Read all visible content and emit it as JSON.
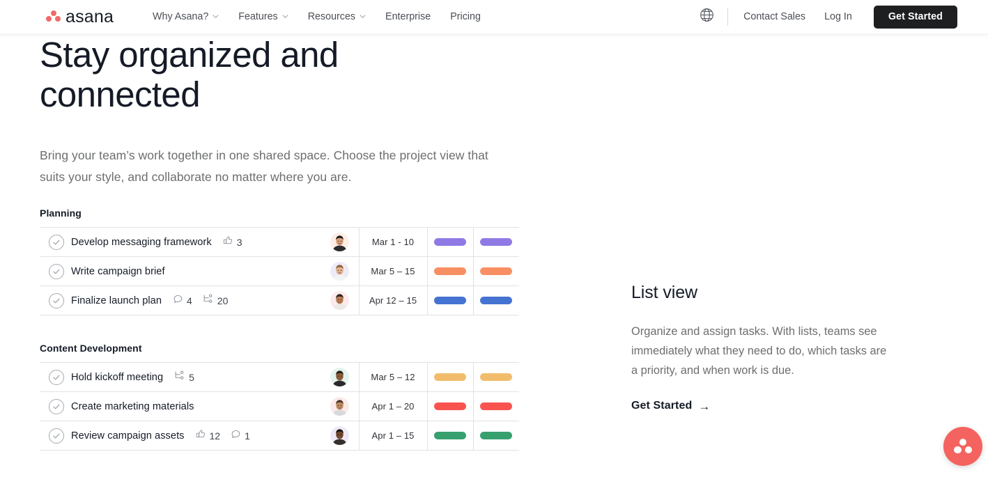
{
  "navbar": {
    "brand": {
      "name": "asana",
      "logo_color": "#f06a6a"
    },
    "links": [
      {
        "label": "Why Asana?",
        "has_dropdown": true
      },
      {
        "label": "Features",
        "has_dropdown": true
      },
      {
        "label": "Resources",
        "has_dropdown": true
      },
      {
        "label": "Enterprise",
        "has_dropdown": false
      },
      {
        "label": "Pricing",
        "has_dropdown": false
      }
    ],
    "language_icon": "globe-icon",
    "contact_sales": "Contact Sales",
    "log_in": "Log In",
    "get_started": "Get Started",
    "cta_bg": "#1e1f21"
  },
  "hero": {
    "heading": "Stay organized and connected",
    "subheading": "Bring your team’s work together in one shared space. Choose the project view that suits your style, and collaborate no matter where you are."
  },
  "board": {
    "groups": [
      {
        "title": "Planning",
        "tasks": [
          {
            "name": "Develop messaging framework",
            "meta": [
              {
                "icon": "thumbs-up-icon",
                "count": "3"
              }
            ],
            "avatar": "avatar-person-1",
            "avatar_bg": "#fdeee6",
            "date": "Mar 1 - 10",
            "tag1_color": "#8f7ae5",
            "tag2_color": "#8f7ae5"
          },
          {
            "name": "Write campaign brief",
            "meta": [],
            "avatar": "avatar-person-2",
            "avatar_bg": "#efeaf7",
            "date": "Mar 5 – 15",
            "tag1_color": "#f88f63",
            "tag2_color": "#f88f63"
          },
          {
            "name": "Finalize launch plan",
            "meta": [
              {
                "icon": "comment-icon",
                "count": "4"
              },
              {
                "icon": "subtask-icon",
                "count": "20"
              }
            ],
            "avatar": "avatar-person-3",
            "avatar_bg": "#fdeaea",
            "date": "Apr 12 – 15",
            "tag1_color": "#4573d2",
            "tag2_color": "#4573d2"
          }
        ]
      },
      {
        "title": "Content Development",
        "tasks": [
          {
            "name": "Hold kickoff meeting",
            "meta": [
              {
                "icon": "subtask-icon",
                "count": "5"
              }
            ],
            "avatar": "avatar-person-4",
            "avatar_bg": "#e3f4ec",
            "date": "Mar 5 – 12",
            "tag1_color": "#f1bd6c",
            "tag2_color": "#f1bd6c"
          },
          {
            "name": "Create marketing materials",
            "meta": [],
            "avatar": "avatar-person-5",
            "avatar_bg": "#fbeaea",
            "date": "Apr 1 – 20",
            "tag1_color": "#f9534f",
            "tag2_color": "#f9534f"
          },
          {
            "name": "Review campaign assets",
            "meta": [
              {
                "icon": "thumbs-up-icon",
                "count": "12"
              },
              {
                "icon": "comment-icon",
                "count": "1"
              }
            ],
            "avatar": "avatar-person-6",
            "avatar_bg": "#efe9f6",
            "date": "Apr 1 – 15",
            "tag1_color": "#37a06f",
            "tag2_color": "#37a06f"
          }
        ]
      }
    ]
  },
  "panel": {
    "title": "List view",
    "body": "Organize and assign tasks. With lists, teams see immediately what they need to do, which tasks are a priority, and when work is due.",
    "link_label": "Get Started",
    "link_arrow": "→"
  },
  "fab": {
    "icon": "asana-logo-icon",
    "color": "#f4635f"
  }
}
